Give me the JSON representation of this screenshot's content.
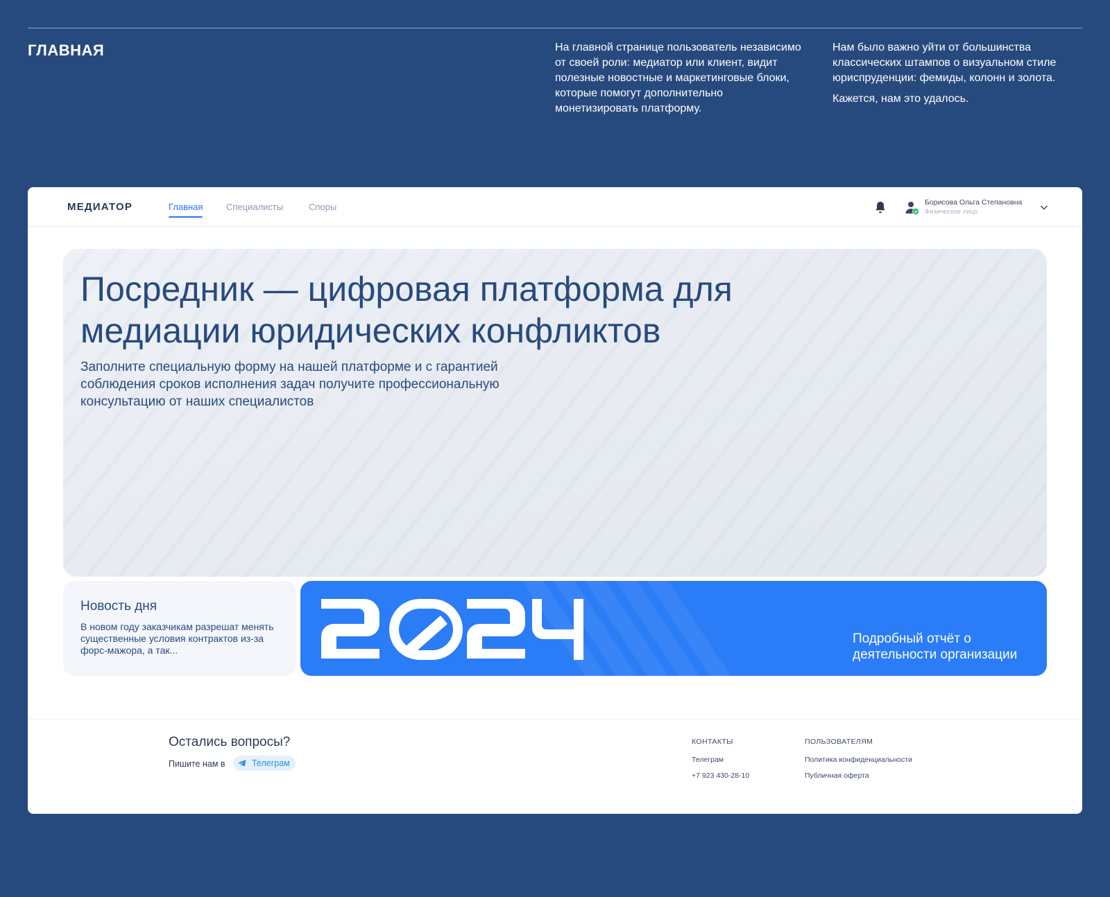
{
  "section": {
    "title": "ГЛАВНАЯ",
    "description_1": "На главной странице пользователь независимо от своей роли: медиатор или клиент, видит полезные новостные и маркетинговые блоки, которые помогут дополнительно монетизировать платформу.",
    "description_2": "Нам было важно уйти от большинства классических штампов о визуальном стиле юриспруденции: фемиды, колонн и золота.",
    "description_3": "Кажется, нам это удалось."
  },
  "header": {
    "logo": "МЕДИАТОР",
    "tabs": [
      {
        "label": "Главная",
        "active": true
      },
      {
        "label": "Специалисты",
        "active": false
      },
      {
        "label": "Споры",
        "active": false
      }
    ],
    "user": {
      "name": "Борисова Ольга Степановна",
      "role": "Физическое лицо"
    },
    "icons": [
      "bell-icon",
      "user-verified-icon",
      "chevron-down-icon"
    ]
  },
  "hero": {
    "title": "Посредник — цифровая платформа для медиации юридических конфликтов",
    "subtitle": "Заполните специальную форму на нашей платформе и с гарантией соблюдения сроков исполнения задач получите профессиональную консультацию от наших специалистов"
  },
  "news": {
    "title": "Новость дня",
    "text": "В новом году заказчикам разрешат менять существенные условия контрактов из-за форс-мажора, а так..."
  },
  "promo": {
    "year": "2024",
    "text": "Подробный отчёт о деятельности организации"
  },
  "footer": {
    "question": "Остались вопросы?",
    "write_us": "Пишите нам в",
    "telegram_button": "Телеграм",
    "contacts": {
      "heading": "КОНТАКТЫ",
      "telegram": "Телеграм",
      "phone": "+7 923 430-28-10"
    },
    "users": {
      "heading": "ПОЛЬЗОВАТЕЛЯМ",
      "privacy": "Политика конфиденциальности",
      "offer": "Публичная оферта"
    }
  },
  "colors": {
    "page_background": "#274a7e",
    "accent": "#2575f5",
    "promo_background": "#2a7cf7",
    "verified_badge": "#1fbf6a"
  }
}
